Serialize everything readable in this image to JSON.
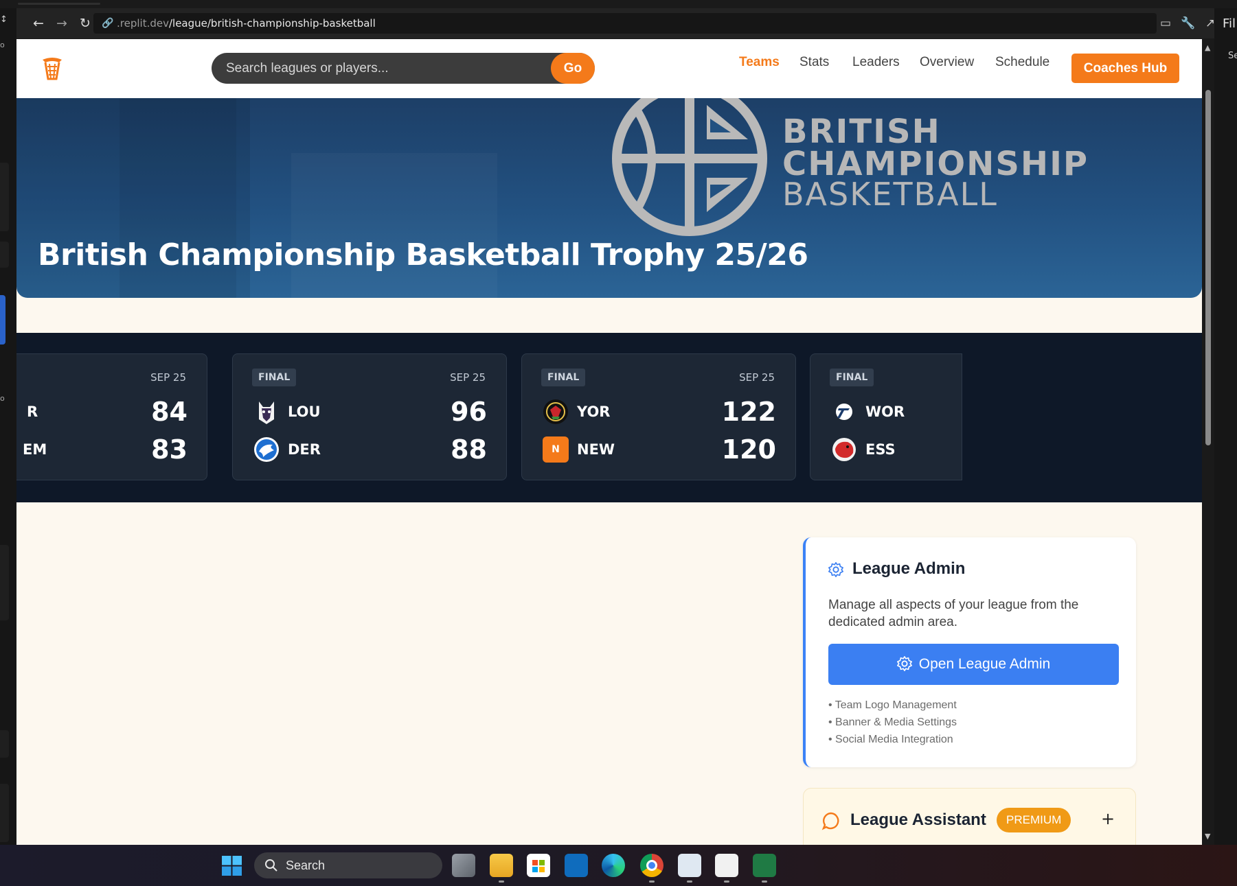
{
  "browser": {
    "url_host": ".replit.dev",
    "url_path": "/league/british-championship-basketball",
    "side_panel_label": "Fil",
    "side_panel_sub": "Se"
  },
  "navbar": {
    "search_placeholder": "Search leagues or players...",
    "go_label": "Go",
    "links": [
      "Teams",
      "Stats",
      "Leaders",
      "Overview",
      "Schedule"
    ],
    "active_link": "Teams",
    "coaches_hub_label": "Coaches Hub"
  },
  "banner": {
    "logo_text_line1": "BRITISH",
    "logo_text_line2": "CHAMPIONSHIP",
    "logo_text_line3": "BASKETBALL",
    "title": "British Championship Basketball Trophy 25/26"
  },
  "scoreboard": {
    "games": [
      {
        "status": "",
        "date": "SEP 25",
        "home": {
          "abbr": "R",
          "score": "84"
        },
        "away": {
          "abbr": "EM",
          "score": "83"
        }
      },
      {
        "status": "FINAL",
        "date": "SEP 25",
        "home": {
          "abbr": "LOU",
          "score": "96"
        },
        "away": {
          "abbr": "DER",
          "score": "88"
        }
      },
      {
        "status": "FINAL",
        "date": "SEP 25",
        "home": {
          "abbr": "YOR",
          "score": "122"
        },
        "away": {
          "abbr": "NEW",
          "score": "120",
          "logo_letter": "N"
        }
      },
      {
        "status": "FINAL",
        "date": "",
        "home": {
          "abbr": "WOR",
          "score": ""
        },
        "away": {
          "abbr": "ESS",
          "score": ""
        }
      }
    ]
  },
  "league_admin": {
    "title": "League Admin",
    "description": "Manage all aspects of your league from the dedicated admin area.",
    "button_label": "Open League Admin",
    "features": [
      "• Team Logo Management",
      "• Banner & Media Settings",
      "• Social Media Integration"
    ]
  },
  "league_assistant": {
    "title": "League Assistant",
    "badge": "PREMIUM",
    "toggle": "+"
  },
  "taskbar": {
    "search_label": "Search"
  },
  "colors": {
    "accent_orange": "#f47a1a",
    "admin_blue": "#3b7ff2",
    "banner_blue": "#225181",
    "scoreboard_bg": "#0e1828"
  }
}
